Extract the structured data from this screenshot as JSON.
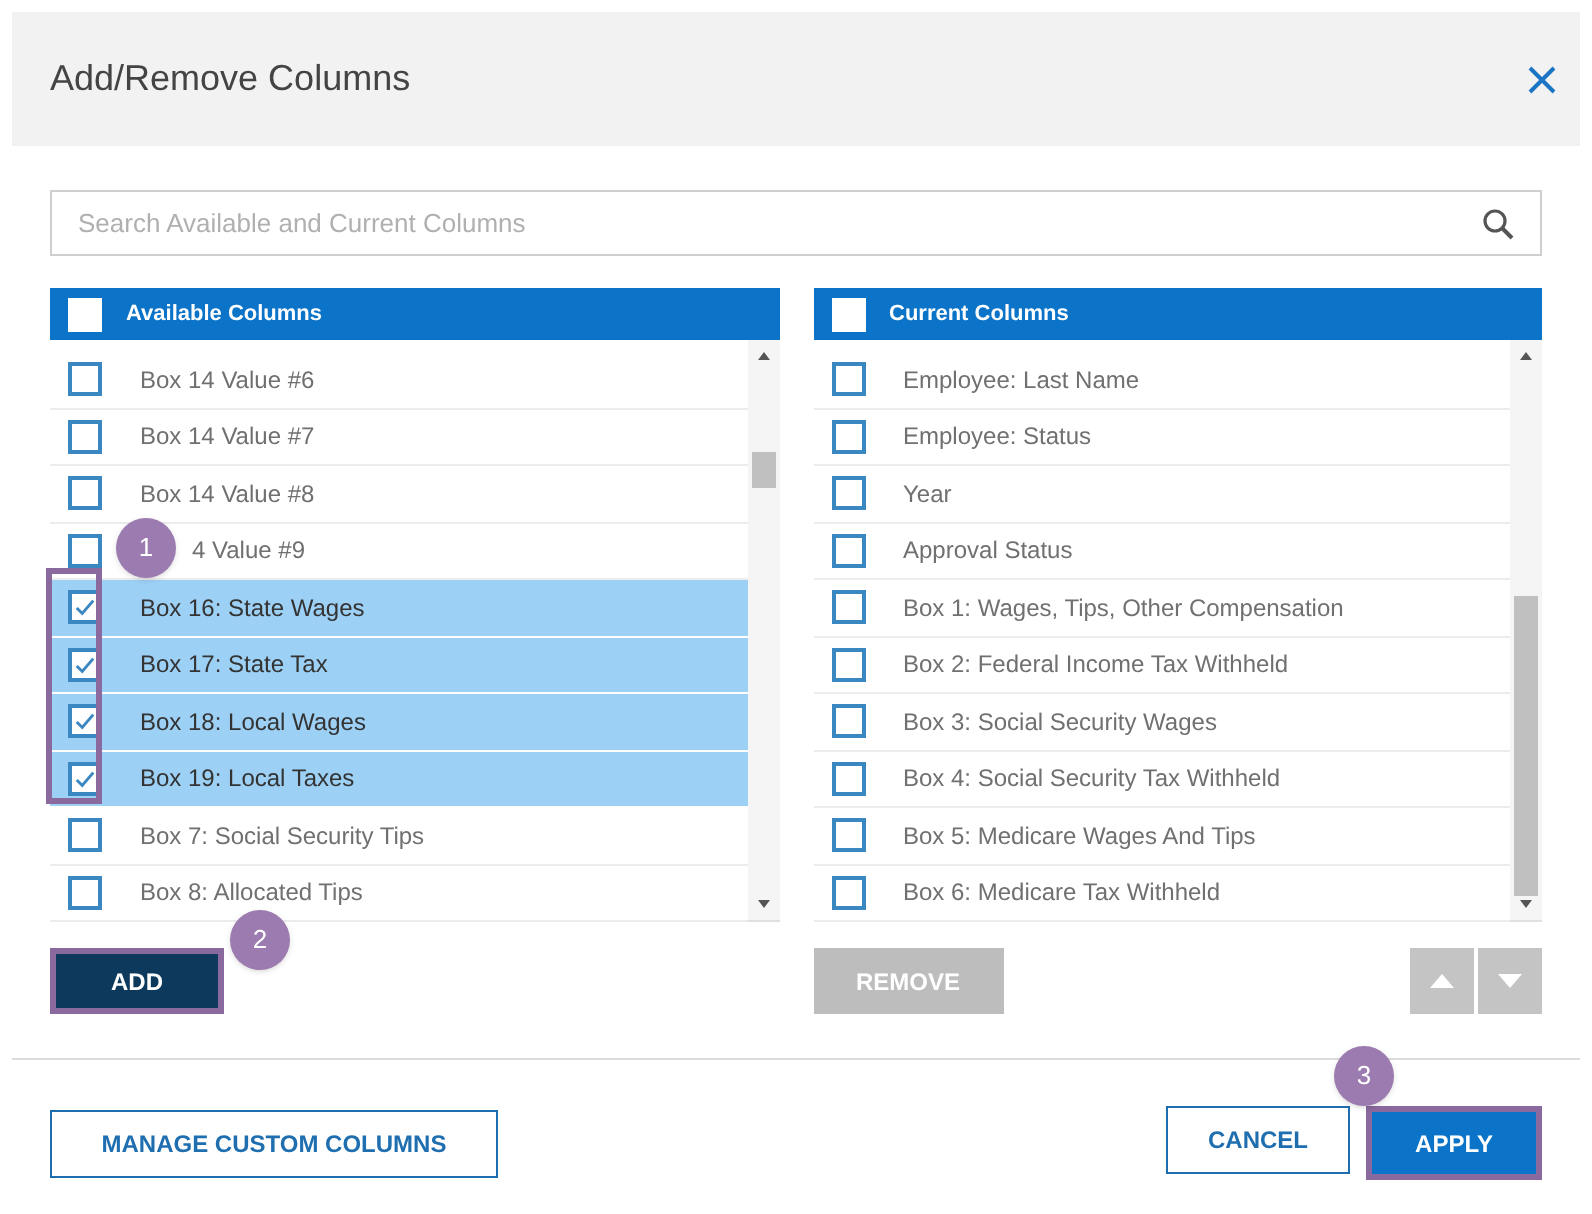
{
  "dialog": {
    "title": "Add/Remove Columns"
  },
  "search": {
    "placeholder": "Search Available and Current Columns"
  },
  "available": {
    "header": "Available Columns",
    "header_checked": false,
    "items": [
      {
        "label": "Box 14 Value #6",
        "checked": false,
        "selected": false
      },
      {
        "label": "Box 14 Value #7",
        "checked": false,
        "selected": false
      },
      {
        "label": "Box 14 Value #8",
        "checked": false,
        "selected": false
      },
      {
        "label": "4 Value #9",
        "checked": false,
        "selected": false
      },
      {
        "label": "Box 16: State Wages",
        "checked": true,
        "selected": true
      },
      {
        "label": "Box 17: State Tax",
        "checked": true,
        "selected": true
      },
      {
        "label": "Box 18: Local Wages",
        "checked": true,
        "selected": true
      },
      {
        "label": "Box 19: Local Taxes",
        "checked": true,
        "selected": true
      },
      {
        "label": "Box 7: Social Security Tips",
        "checked": false,
        "selected": false
      },
      {
        "label": "Box 8: Allocated Tips",
        "checked": false,
        "selected": false
      }
    ]
  },
  "current": {
    "header": "Current Columns",
    "header_checked": false,
    "items": [
      {
        "label": "Employee: Last Name",
        "checked": false,
        "selected": false
      },
      {
        "label": "Employee: Status",
        "checked": false,
        "selected": false
      },
      {
        "label": "Year",
        "checked": false,
        "selected": false
      },
      {
        "label": "Approval Status",
        "checked": false,
        "selected": false
      },
      {
        "label": "Box 1: Wages, Tips, Other Compensation",
        "checked": false,
        "selected": false
      },
      {
        "label": "Box 2: Federal Income Tax Withheld",
        "checked": false,
        "selected": false
      },
      {
        "label": "Box 3: Social Security Wages",
        "checked": false,
        "selected": false
      },
      {
        "label": "Box 4: Social Security Tax Withheld",
        "checked": false,
        "selected": false
      },
      {
        "label": "Box 5: Medicare Wages And Tips",
        "checked": false,
        "selected": false
      },
      {
        "label": "Box 6: Medicare Tax Withheld",
        "checked": false,
        "selected": false
      }
    ]
  },
  "buttons": {
    "add": "ADD",
    "remove": "REMOVE",
    "remove_disabled": true,
    "manage": "MANAGE CUSTOM COLUMNS",
    "cancel": "CANCEL",
    "apply": "APPLY"
  },
  "annotations": [
    {
      "number": "1"
    },
    {
      "number": "2"
    },
    {
      "number": "3"
    }
  ]
}
